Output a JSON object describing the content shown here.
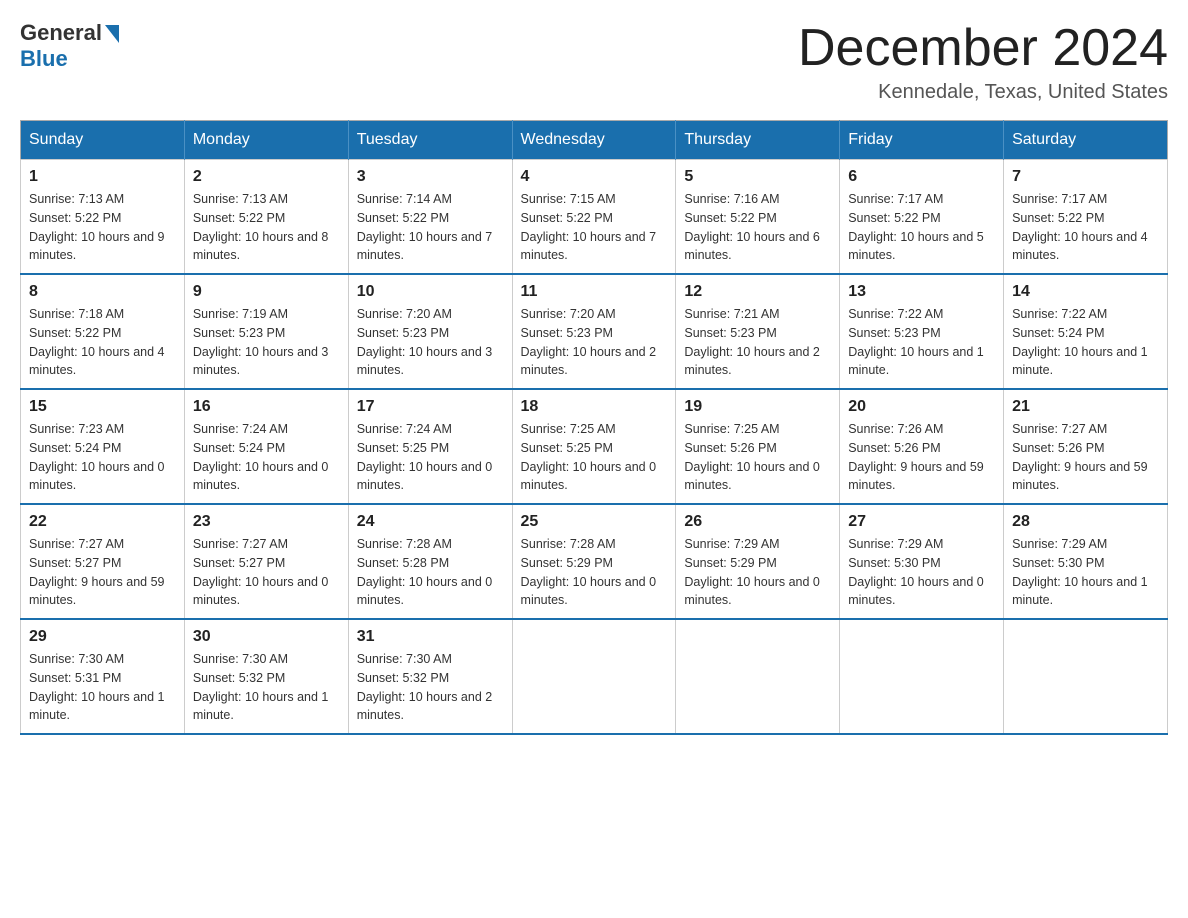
{
  "header": {
    "logo_general": "General",
    "logo_blue": "Blue",
    "month_title": "December 2024",
    "location": "Kennedale, Texas, United States"
  },
  "weekdays": [
    "Sunday",
    "Monday",
    "Tuesday",
    "Wednesday",
    "Thursday",
    "Friday",
    "Saturday"
  ],
  "weeks": [
    [
      {
        "day": "1",
        "sunrise": "7:13 AM",
        "sunset": "5:22 PM",
        "daylight": "10 hours and 9 minutes."
      },
      {
        "day": "2",
        "sunrise": "7:13 AM",
        "sunset": "5:22 PM",
        "daylight": "10 hours and 8 minutes."
      },
      {
        "day": "3",
        "sunrise": "7:14 AM",
        "sunset": "5:22 PM",
        "daylight": "10 hours and 7 minutes."
      },
      {
        "day": "4",
        "sunrise": "7:15 AM",
        "sunset": "5:22 PM",
        "daylight": "10 hours and 7 minutes."
      },
      {
        "day": "5",
        "sunrise": "7:16 AM",
        "sunset": "5:22 PM",
        "daylight": "10 hours and 6 minutes."
      },
      {
        "day": "6",
        "sunrise": "7:17 AM",
        "sunset": "5:22 PM",
        "daylight": "10 hours and 5 minutes."
      },
      {
        "day": "7",
        "sunrise": "7:17 AM",
        "sunset": "5:22 PM",
        "daylight": "10 hours and 4 minutes."
      }
    ],
    [
      {
        "day": "8",
        "sunrise": "7:18 AM",
        "sunset": "5:22 PM",
        "daylight": "10 hours and 4 minutes."
      },
      {
        "day": "9",
        "sunrise": "7:19 AM",
        "sunset": "5:23 PM",
        "daylight": "10 hours and 3 minutes."
      },
      {
        "day": "10",
        "sunrise": "7:20 AM",
        "sunset": "5:23 PM",
        "daylight": "10 hours and 3 minutes."
      },
      {
        "day": "11",
        "sunrise": "7:20 AM",
        "sunset": "5:23 PM",
        "daylight": "10 hours and 2 minutes."
      },
      {
        "day": "12",
        "sunrise": "7:21 AM",
        "sunset": "5:23 PM",
        "daylight": "10 hours and 2 minutes."
      },
      {
        "day": "13",
        "sunrise": "7:22 AM",
        "sunset": "5:23 PM",
        "daylight": "10 hours and 1 minute."
      },
      {
        "day": "14",
        "sunrise": "7:22 AM",
        "sunset": "5:24 PM",
        "daylight": "10 hours and 1 minute."
      }
    ],
    [
      {
        "day": "15",
        "sunrise": "7:23 AM",
        "sunset": "5:24 PM",
        "daylight": "10 hours and 0 minutes."
      },
      {
        "day": "16",
        "sunrise": "7:24 AM",
        "sunset": "5:24 PM",
        "daylight": "10 hours and 0 minutes."
      },
      {
        "day": "17",
        "sunrise": "7:24 AM",
        "sunset": "5:25 PM",
        "daylight": "10 hours and 0 minutes."
      },
      {
        "day": "18",
        "sunrise": "7:25 AM",
        "sunset": "5:25 PM",
        "daylight": "10 hours and 0 minutes."
      },
      {
        "day": "19",
        "sunrise": "7:25 AM",
        "sunset": "5:26 PM",
        "daylight": "10 hours and 0 minutes."
      },
      {
        "day": "20",
        "sunrise": "7:26 AM",
        "sunset": "5:26 PM",
        "daylight": "9 hours and 59 minutes."
      },
      {
        "day": "21",
        "sunrise": "7:27 AM",
        "sunset": "5:26 PM",
        "daylight": "9 hours and 59 minutes."
      }
    ],
    [
      {
        "day": "22",
        "sunrise": "7:27 AM",
        "sunset": "5:27 PM",
        "daylight": "9 hours and 59 minutes."
      },
      {
        "day": "23",
        "sunrise": "7:27 AM",
        "sunset": "5:27 PM",
        "daylight": "10 hours and 0 minutes."
      },
      {
        "day": "24",
        "sunrise": "7:28 AM",
        "sunset": "5:28 PM",
        "daylight": "10 hours and 0 minutes."
      },
      {
        "day": "25",
        "sunrise": "7:28 AM",
        "sunset": "5:29 PM",
        "daylight": "10 hours and 0 minutes."
      },
      {
        "day": "26",
        "sunrise": "7:29 AM",
        "sunset": "5:29 PM",
        "daylight": "10 hours and 0 minutes."
      },
      {
        "day": "27",
        "sunrise": "7:29 AM",
        "sunset": "5:30 PM",
        "daylight": "10 hours and 0 minutes."
      },
      {
        "day": "28",
        "sunrise": "7:29 AM",
        "sunset": "5:30 PM",
        "daylight": "10 hours and 1 minute."
      }
    ],
    [
      {
        "day": "29",
        "sunrise": "7:30 AM",
        "sunset": "5:31 PM",
        "daylight": "10 hours and 1 minute."
      },
      {
        "day": "30",
        "sunrise": "7:30 AM",
        "sunset": "5:32 PM",
        "daylight": "10 hours and 1 minute."
      },
      {
        "day": "31",
        "sunrise": "7:30 AM",
        "sunset": "5:32 PM",
        "daylight": "10 hours and 2 minutes."
      },
      null,
      null,
      null,
      null
    ]
  ],
  "labels": {
    "sunrise_prefix": "Sunrise: ",
    "sunset_prefix": "Sunset: ",
    "daylight_prefix": "Daylight: "
  }
}
